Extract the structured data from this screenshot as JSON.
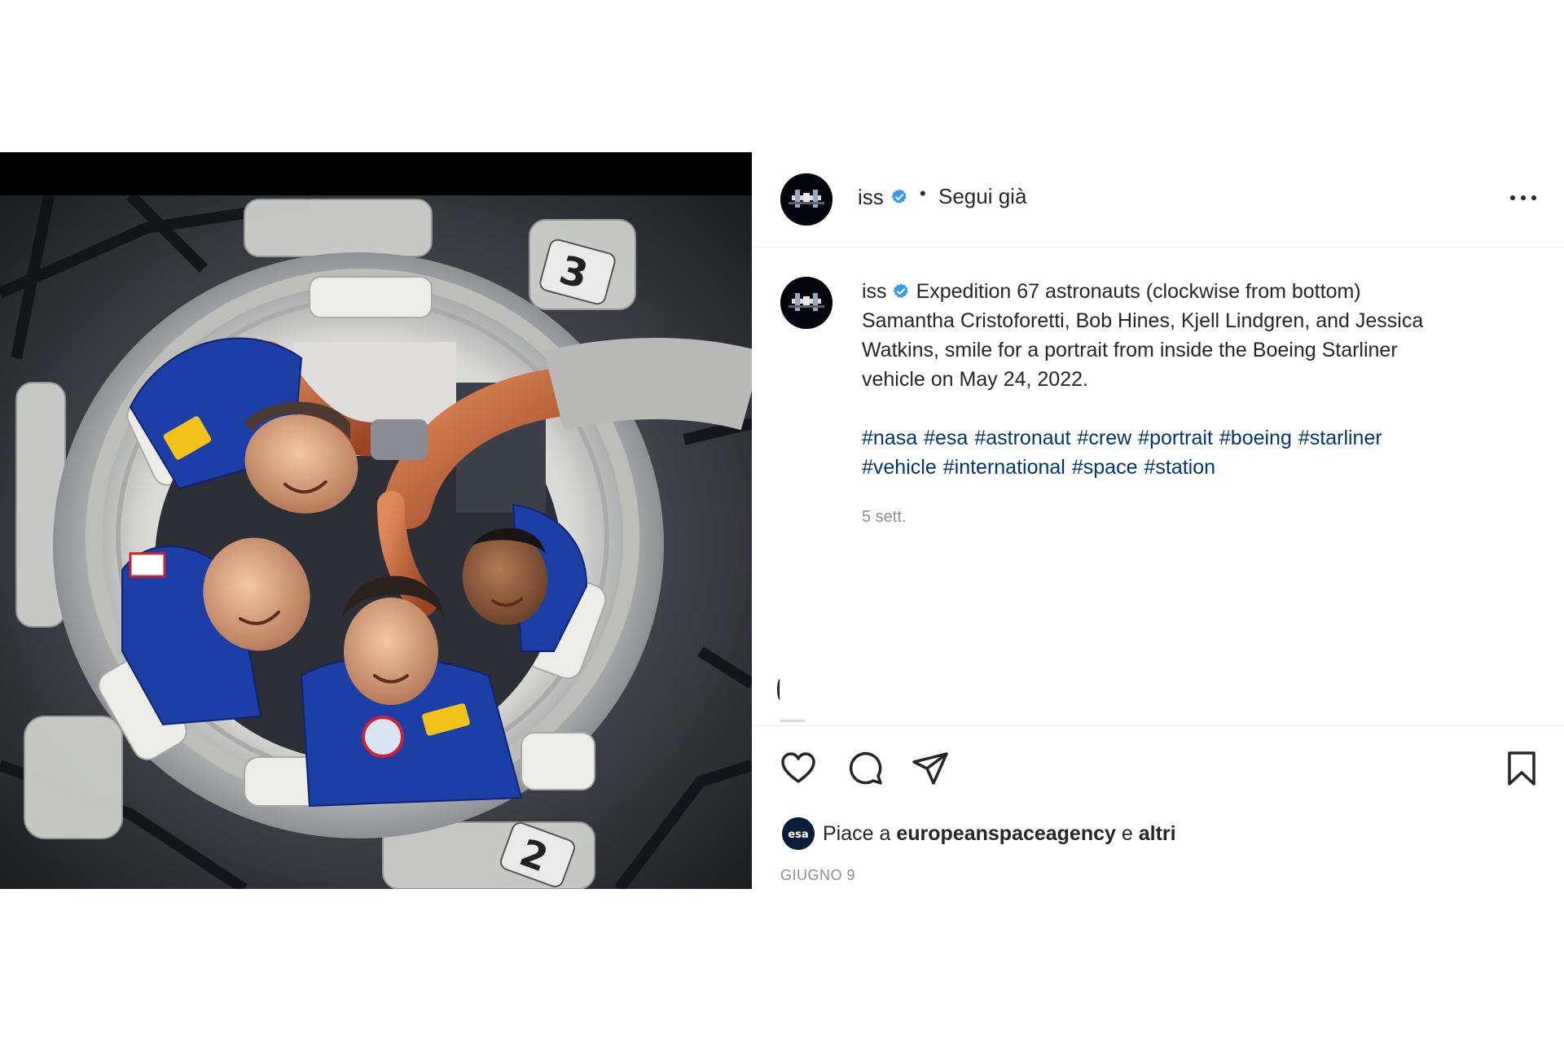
{
  "post": {
    "image_alt": "Expedition 67 astronauts inside the Boeing Starliner hatch",
    "image_patches": [
      "3",
      "2"
    ]
  },
  "header": {
    "username": "iss",
    "separator": "•",
    "follow_label": "Segui già"
  },
  "caption": {
    "username": "iss",
    "lines": [
      "Expedition 67 astronauts (clockwise from bottom)",
      "Samantha Cristoforetti, Bob Hines, Kjell Lindgren, and Jessica",
      "Watkins, smile for a portrait from inside the Boeing Starliner",
      "vehicle on May 24, 2022."
    ],
    "hashtags_line1": [
      "#nasa",
      "#esa",
      "#astronaut",
      "#crew",
      "#portrait",
      "#boeing",
      "#starliner"
    ],
    "hashtags_line2": [
      "#vehicle",
      "#international",
      "#space",
      "#station"
    ],
    "time_ago": "5 sett."
  },
  "likes": {
    "prefix": "Piace a ",
    "user": "europeanspaceagency",
    "middle": " e ",
    "suffix": "altri",
    "avatar_label": "esa"
  },
  "date": "GIUGNO 9",
  "colors": {
    "verified": "#3897f0",
    "hashtag": "#00376b",
    "muted": "#8e8e8e",
    "suit_blue": "#1b3fa6",
    "hose_orange": "#c8643a"
  },
  "icons": [
    "heart-icon",
    "comment-icon",
    "share-icon",
    "bookmark-icon",
    "verified-icon",
    "more-icon"
  ]
}
